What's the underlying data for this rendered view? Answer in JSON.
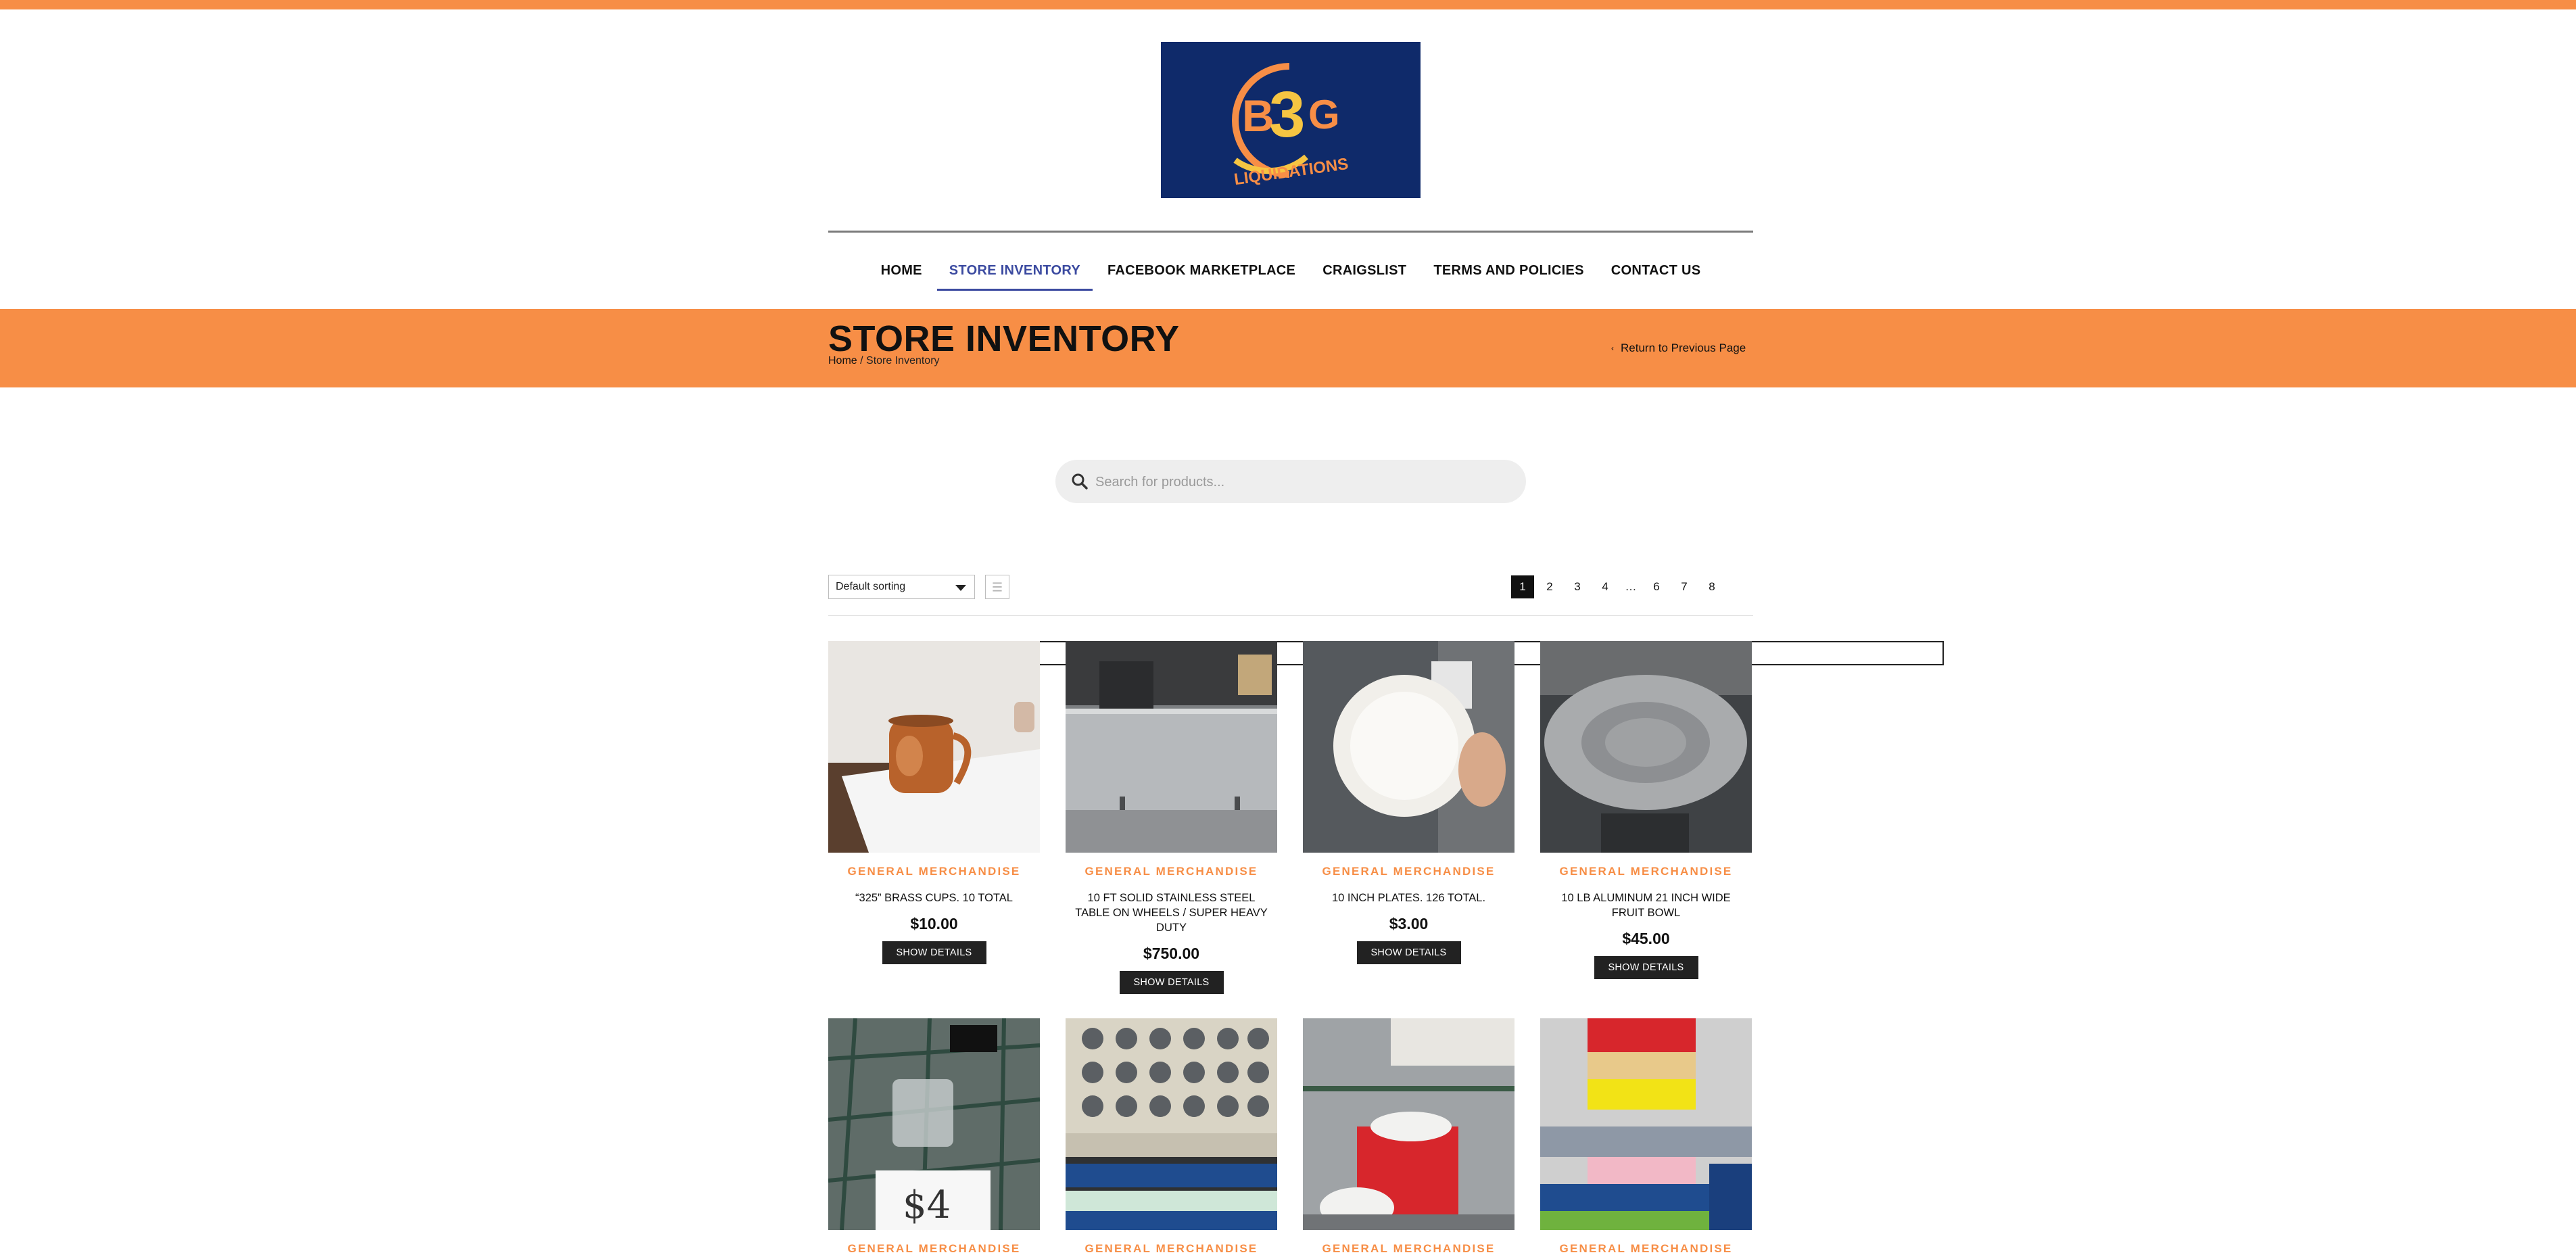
{
  "brand": {
    "accent": "#f78e46",
    "nav_active": "#3b4aa0",
    "logo_bg": "#0f2a6a",
    "logo_text": "B3G",
    "logo_tagline": "LIQUIDATIONS"
  },
  "nav": {
    "items": [
      {
        "label": "HOME",
        "active": false
      },
      {
        "label": "STORE INVENTORY",
        "active": true
      },
      {
        "label": "FACEBOOK MARKETPLACE",
        "active": false
      },
      {
        "label": "CRAIGSLIST",
        "active": false
      },
      {
        "label": "TERMS AND POLICIES",
        "active": false
      },
      {
        "label": "CONTACT US",
        "active": false
      }
    ]
  },
  "banner": {
    "title": "STORE INVENTORY",
    "breadcrumb_home": "Home",
    "breadcrumb_sep": " / ",
    "breadcrumb_current": "Store Inventory",
    "return_label": "Return to Previous Page"
  },
  "search": {
    "placeholder": "Search for products...",
    "icon": "search-icon"
  },
  "toolbar": {
    "sort_value": "Default sorting",
    "list_view_icon": "list-view-icon",
    "grid_view_icon": "grid-view-icon",
    "pages": [
      "1",
      "2",
      "3",
      "4",
      "…",
      "6",
      "7",
      "8"
    ],
    "current_page": "1"
  },
  "products": [
    {
      "category": "GENERAL MERCHANDISE",
      "title": "“325” BRASS CUPS. 10 TOTAL",
      "price": "$10.00",
      "button": "SHOW DETAILS",
      "image": "copper-mug"
    },
    {
      "category": "GENERAL MERCHANDISE",
      "title": "10 FT SOLID STAINLESS STEEL TABLE ON WHEELS / SUPER HEAVY DUTY",
      "price": "$750.00",
      "button": "SHOW DETAILS",
      "image": "steel-table"
    },
    {
      "category": "GENERAL MERCHANDISE",
      "title": "10 INCH PLATES. 126 TOTAL.",
      "price": "$3.00",
      "button": "SHOW DETAILS",
      "image": "white-plate"
    },
    {
      "category": "GENERAL MERCHANDISE",
      "title": "10 LB ALUMINUM 21 INCH WIDE FRUIT BOWL",
      "price": "$45.00",
      "button": "SHOW DETAILS",
      "image": "aluminum-bowl"
    },
    {
      "category": "GENERAL MERCHANDISE",
      "title": "",
      "price": "",
      "button": "",
      "image": "glass-tumblers"
    },
    {
      "category": "GENERAL MERCHANDISE",
      "title": "",
      "price": "",
      "button": "",
      "image": "glass-racks"
    },
    {
      "category": "GENERAL MERCHANDISE",
      "title": "",
      "price": "",
      "button": "",
      "image": "plates-shelf"
    },
    {
      "category": "GENERAL MERCHANDISE",
      "title": "",
      "price": "",
      "button": "",
      "image": "dish-racks"
    }
  ]
}
